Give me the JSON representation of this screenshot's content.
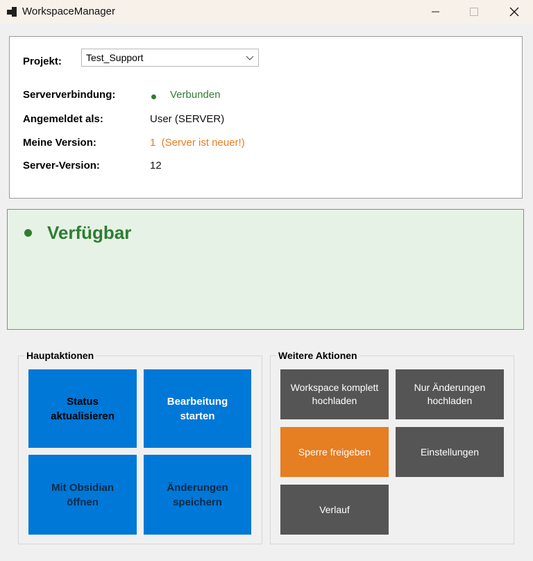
{
  "window": {
    "title": "WorkspaceManager"
  },
  "project": {
    "label": "Projekt:",
    "selected": "Test_Support"
  },
  "info": {
    "connection_label": "Serververbindung:",
    "connection_value": "Verbunden",
    "user_label": "Angemeldet als:",
    "user_value": "User (SERVER)",
    "my_version_label": "Meine Version:",
    "my_version_value": "1  (Server ist neuer!)",
    "server_version_label": "Server-Version:",
    "server_version_value": "12"
  },
  "status": {
    "text": "Verfügbar"
  },
  "main_actions": {
    "title": "Hauptaktionen",
    "buttons": [
      {
        "label": "Status\naktualisieren"
      },
      {
        "label": "Bearbeitung\nstarten"
      },
      {
        "label": "Mit Obsidian\nöffnen"
      },
      {
        "label": "Änderungen\nspeichern"
      }
    ]
  },
  "more_actions": {
    "title": "Weitere Aktionen",
    "buttons": [
      {
        "label": "Workspace komplett\nhochladen"
      },
      {
        "label": "Nur Änderungen\nhochladen"
      },
      {
        "label": "Sperre freigeben"
      },
      {
        "label": "Einstellungen"
      },
      {
        "label": "Verlauf"
      }
    ]
  },
  "colors": {
    "accent_blue": "#0078d7",
    "ok_green": "#2e7d32",
    "warning_orange": "#e67e22",
    "tile_grey": "#555555",
    "status_bg": "#e6f2e6"
  }
}
